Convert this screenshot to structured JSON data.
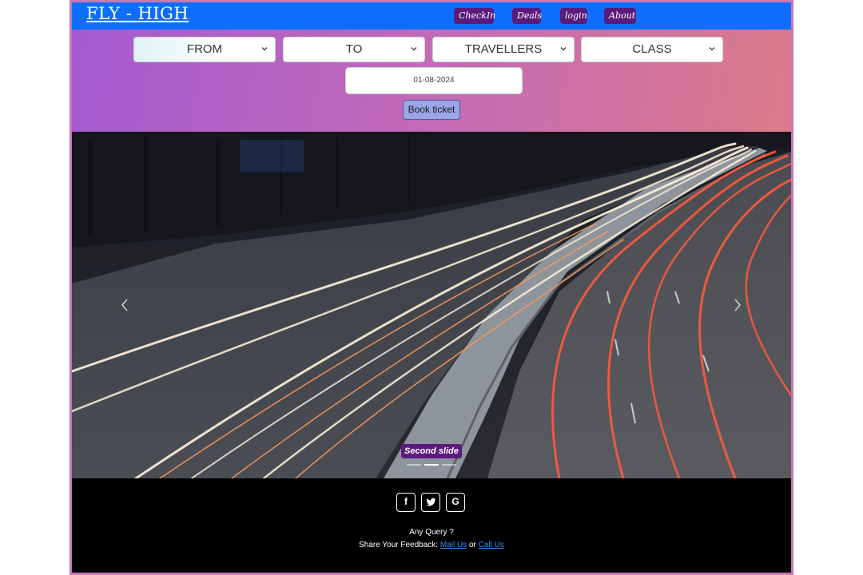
{
  "navbar": {
    "brand": "FLY - HIGH",
    "links": [
      "CheckIn",
      "Deals",
      "login",
      "About"
    ],
    "color": "#0d6efd",
    "link_color": "#5a1b7d"
  },
  "form": {
    "from_label": "FROM",
    "to_label": "TO",
    "travellers_label": "TRAVELLERS",
    "class_label": "CLASS",
    "date_value": "01-08-2024",
    "book_label": "Book ticket"
  },
  "carousel": {
    "caption": "Second slide",
    "slide_count": 3,
    "active_index": 1,
    "prev_icon": "chevron-left-icon",
    "next_icon": "chevron-right-icon"
  },
  "footer": {
    "social": [
      {
        "name": "facebook-icon",
        "glyph": "f"
      },
      {
        "name": "twitter-icon",
        "glyph": "t"
      },
      {
        "name": "google-icon",
        "glyph": "G"
      }
    ],
    "query_text": "Any Query ?",
    "feedback_text": "Share Your Feedback:",
    "mail_link": "Mail Us",
    "or_text": "or",
    "call_link": "Call Us"
  }
}
